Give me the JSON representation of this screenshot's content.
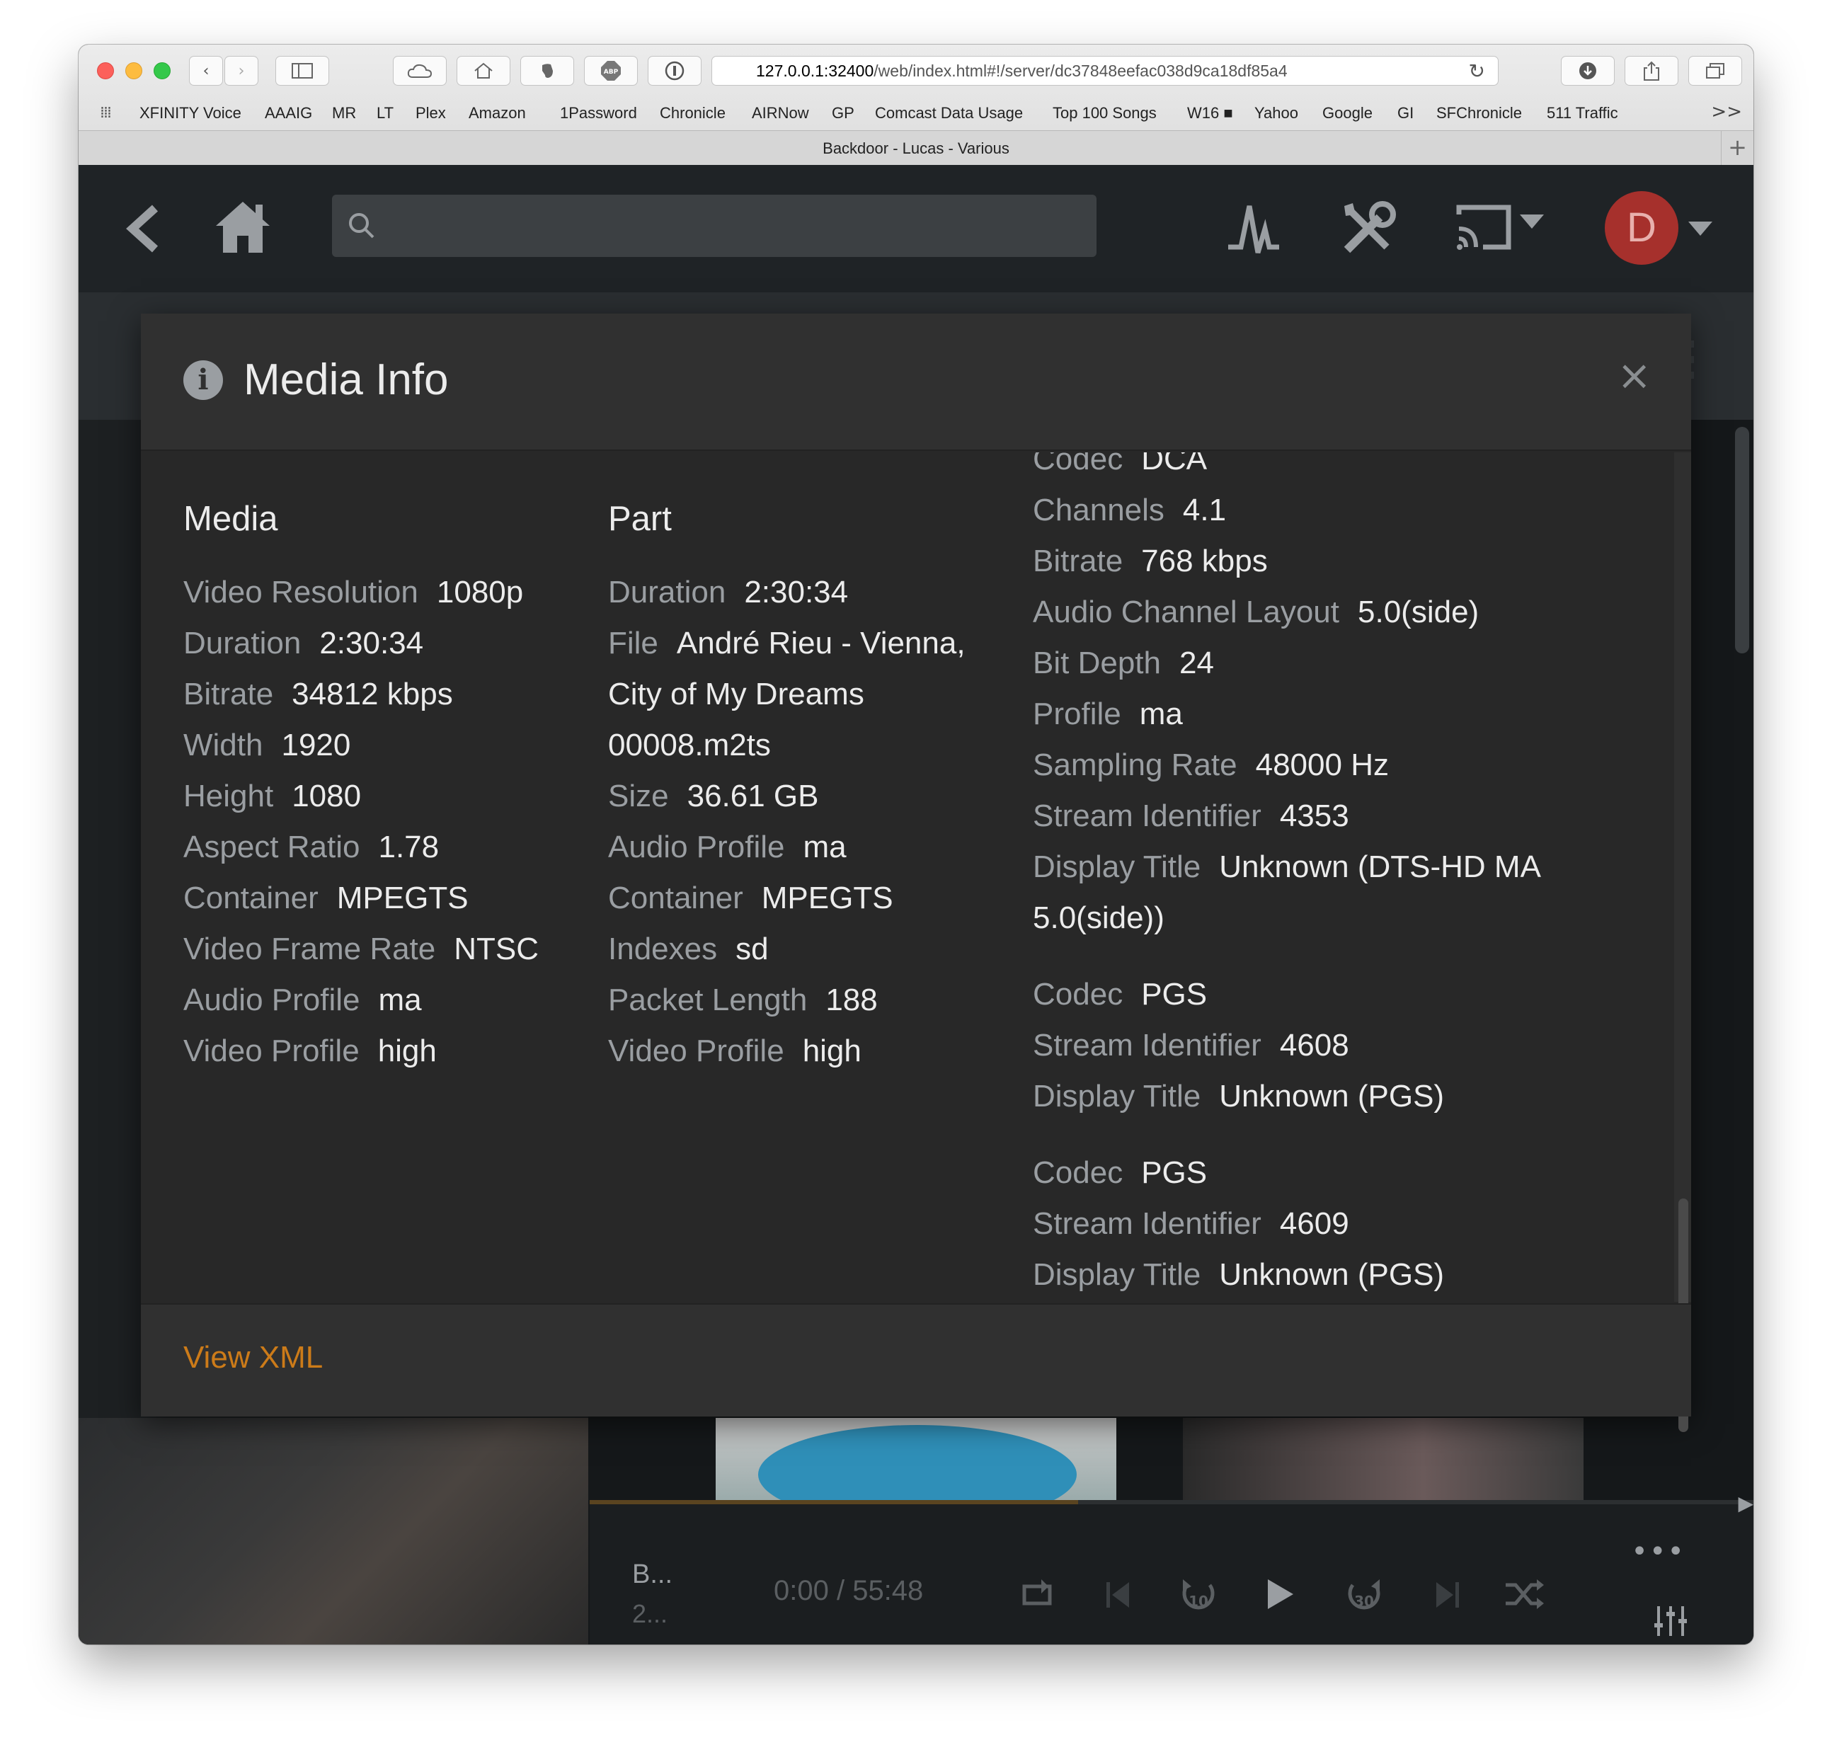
{
  "browser": {
    "url_host": "127.0.0.1:32400",
    "url_path": "/web/index.html#!/server/dc37848eefac038d9ca18df85a4",
    "bookmarks": [
      "XFINITY Voice",
      "AAAIG",
      "MR",
      "LT",
      "Plex",
      "Amazon",
      "1Password",
      "Chronicle",
      "AIRNow",
      "GP",
      "Comcast Data Usage",
      "Top 100 Songs",
      "W16 ■",
      "Yahoo",
      "Google",
      "GI",
      "SFChronicle",
      "511 Traffic"
    ],
    "bookmarks_more": ">>",
    "tab_title": "Backdoor - Lucas - Various",
    "tab_plus": "+"
  },
  "plex": {
    "avatar_letter": "D",
    "search_placeholder": ""
  },
  "modal": {
    "title": "Media Info",
    "close": "×",
    "view_xml": "View XML",
    "media": {
      "heading": "Media",
      "rows": [
        {
          "k": "Video Resolution",
          "v": "1080p"
        },
        {
          "k": "Duration",
          "v": "2:30:34"
        },
        {
          "k": "Bitrate",
          "v": "34812 kbps"
        },
        {
          "k": "Width",
          "v": "1920"
        },
        {
          "k": "Height",
          "v": "1080"
        },
        {
          "k": "Aspect Ratio",
          "v": "1.78"
        },
        {
          "k": "Container",
          "v": "MPEGTS"
        },
        {
          "k": "Video Frame Rate",
          "v": "NTSC"
        },
        {
          "k": "Audio Profile",
          "v": "ma"
        },
        {
          "k": "Video Profile",
          "v": "high"
        }
      ]
    },
    "part": {
      "heading": "Part",
      "duration": {
        "k": "Duration",
        "v": "2:30:34"
      },
      "file": {
        "k": "File",
        "v1": "André Rieu - Vienna,",
        "v2": "City of My Dreams",
        "v3": "00008.m2ts"
      },
      "rows": [
        {
          "k": "Size",
          "v": "36.61 GB"
        },
        {
          "k": "Audio Profile",
          "v": "ma"
        },
        {
          "k": "Container",
          "v": "MPEGTS"
        },
        {
          "k": "Indexes",
          "v": "sd"
        },
        {
          "k": "Packet Length",
          "v": "188"
        },
        {
          "k": "Video Profile",
          "v": "high"
        }
      ]
    },
    "streams": {
      "audio": [
        {
          "k": "Codec",
          "v": "DCA"
        },
        {
          "k": "Channels",
          "v": "4.1"
        },
        {
          "k": "Bitrate",
          "v": "768 kbps"
        },
        {
          "k": "Audio Channel Layout",
          "v": "5.0(side)"
        },
        {
          "k": "Bit Depth",
          "v": "24"
        },
        {
          "k": "Profile",
          "v": "ma"
        },
        {
          "k": "Sampling Rate",
          "v": "48000 Hz"
        },
        {
          "k": "Stream Identifier",
          "v": "4353"
        }
      ],
      "audio_title": {
        "k": "Display Title",
        "v1": "Unknown (DTS-HD MA",
        "v2": "5.0(side))"
      },
      "sub1": [
        {
          "k": "Codec",
          "v": "PGS"
        },
        {
          "k": "Stream Identifier",
          "v": "4608"
        },
        {
          "k": "Display Title",
          "v": "Unknown (PGS)"
        }
      ],
      "sub2": [
        {
          "k": "Codec",
          "v": "PGS"
        },
        {
          "k": "Stream Identifier",
          "v": "4609"
        },
        {
          "k": "Display Title",
          "v": "Unknown (PGS)"
        }
      ]
    }
  },
  "player": {
    "title": "B...",
    "subtitle": "2...",
    "time": "0:00 / 55:48",
    "more": "•••",
    "skip_back_label": "10",
    "skip_fwd_label": "30"
  },
  "colors": {
    "accent": "#cc7b19",
    "avatar_bg": "#a6302c",
    "modal_bg": "#282828",
    "label": "#9a9ea2",
    "value": "#ececec"
  }
}
